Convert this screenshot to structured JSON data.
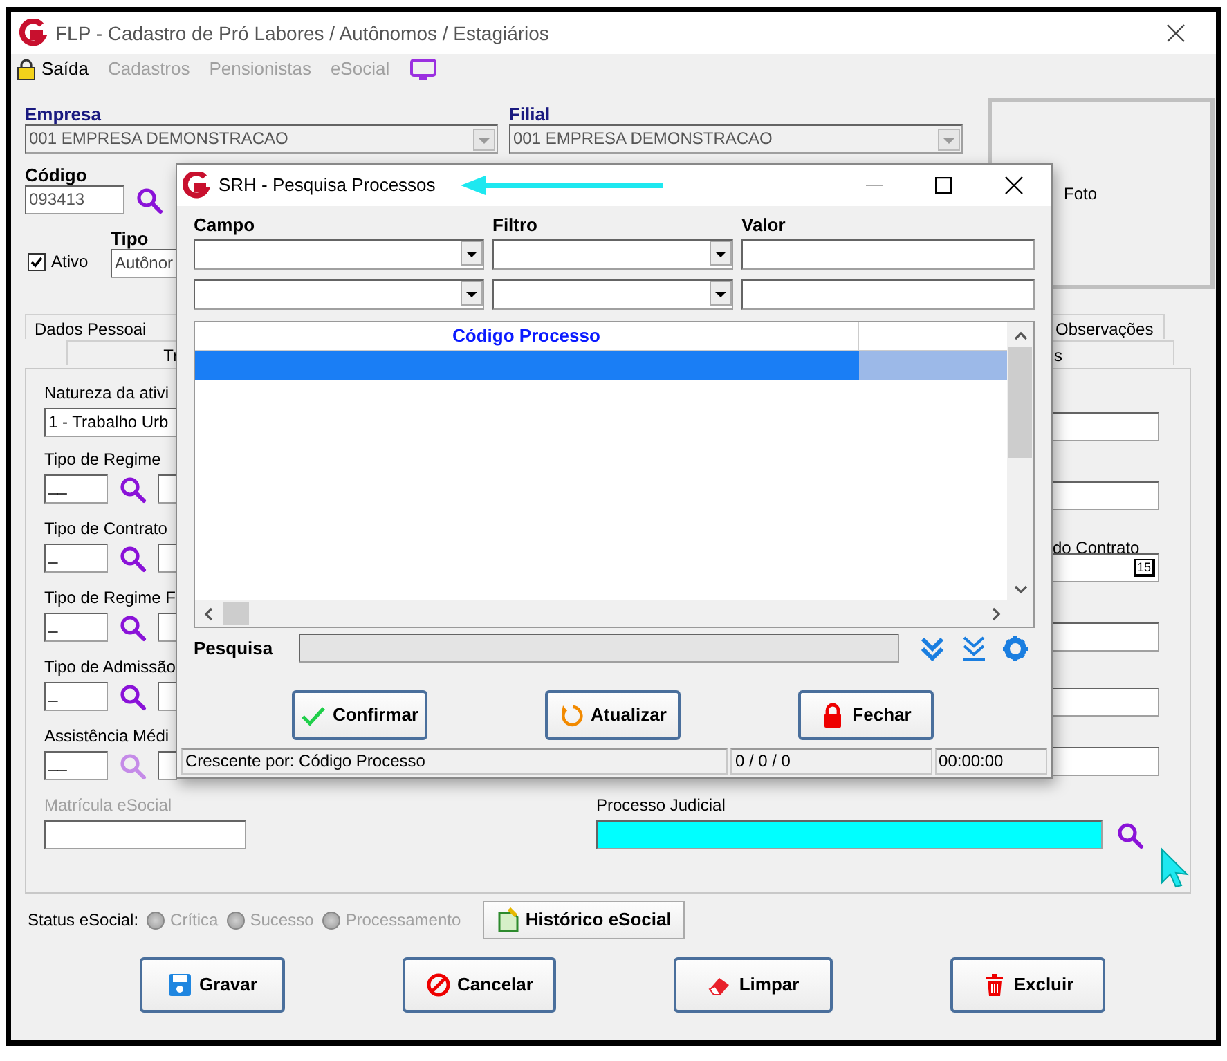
{
  "window": {
    "title": "FLP - Cadastro de Pró Labores / Autônomos / Estagiários"
  },
  "menu": [
    {
      "label": "Saída",
      "disabled": false
    },
    {
      "label": "Cadastros",
      "disabled": true
    },
    {
      "label": "Pensionistas",
      "disabled": true
    },
    {
      "label": "eSocial",
      "disabled": true
    }
  ],
  "header": {
    "empresa_label": "Empresa",
    "empresa_value": "001 EMPRESA DEMONSTRACAO",
    "filial_label": "Filial",
    "filial_value": "001 EMPRESA DEMONSTRACAO",
    "codigo_label": "Código",
    "codigo_value": "093413",
    "tipo_label": "Tipo",
    "tipo_value": "Autônor",
    "ativo": {
      "label": "Ativo",
      "checked": true
    },
    "photo_label": "Foto"
  },
  "tabs_row1": [
    {
      "label": "Dados Pessoai"
    },
    {
      "label": "Observações"
    }
  ],
  "tabs_row2": [
    {
      "label": "Tr"
    },
    {
      "label": "s"
    }
  ],
  "left_fields": [
    {
      "kind": "combo",
      "label": "Natureza da ativi",
      "value": "1 - Trabalho Urb"
    },
    {
      "kind": "lookup",
      "label": "Tipo de Regime",
      "value": "__",
      "disabled": false
    },
    {
      "kind": "lookup",
      "label": "Tipo de Contrato",
      "value": "_",
      "disabled": false
    },
    {
      "kind": "lookup",
      "label": "Tipo de Regime F",
      "value": "_",
      "disabled": false
    },
    {
      "kind": "lookup",
      "label": "Tipo de Admissão",
      "value": "_",
      "disabled": false
    },
    {
      "kind": "lookup",
      "label": "Assistência Médi",
      "value": "__",
      "disabled": true
    },
    {
      "kind": "text",
      "label": "Matrícula eSocial",
      "disabled": true
    }
  ],
  "right_fields": [
    {
      "kind": "text"
    },
    {
      "kind": "text"
    },
    {
      "kind": "date",
      "label": "do Contrato",
      "calendar_text": "15"
    },
    {
      "kind": "text"
    },
    {
      "kind": "text"
    },
    {
      "kind": "text"
    }
  ],
  "processo": {
    "label": "Processo Judicial",
    "highlighted": true
  },
  "status_esocial": {
    "label": "Status eSocial:",
    "options": [
      {
        "label": "Crítica",
        "selected": false,
        "disabled": true
      },
      {
        "label": "Sucesso",
        "selected": false,
        "disabled": true
      },
      {
        "label": "Processamento",
        "selected": false,
        "disabled": true
      }
    ],
    "history_button": "Histórico eSocial"
  },
  "buttons": [
    {
      "label": "Gravar",
      "kind": "save"
    },
    {
      "label": "Cancelar",
      "kind": "cancel"
    },
    {
      "label": "Limpar",
      "kind": "clear"
    },
    {
      "label": "Excluir",
      "kind": "delete"
    }
  ],
  "dialog": {
    "title": "SRH - Pesquisa Processos",
    "filter_labels": [
      "Campo",
      "Filtro",
      "Valor"
    ],
    "grid": {
      "columns": [
        "Código Processo"
      ],
      "rows": [
        {
          "selected": true
        }
      ]
    },
    "search_label": "Pesquisa",
    "buttons": [
      {
        "label": "Confirmar",
        "kind": "confirm"
      },
      {
        "label": "Atualizar",
        "kind": "refresh"
      },
      {
        "label": "Fechar",
        "kind": "close"
      }
    ],
    "status": [
      "Crescente por: Código Processo",
      "0 / 0 / 0",
      "00:00:00"
    ]
  }
}
